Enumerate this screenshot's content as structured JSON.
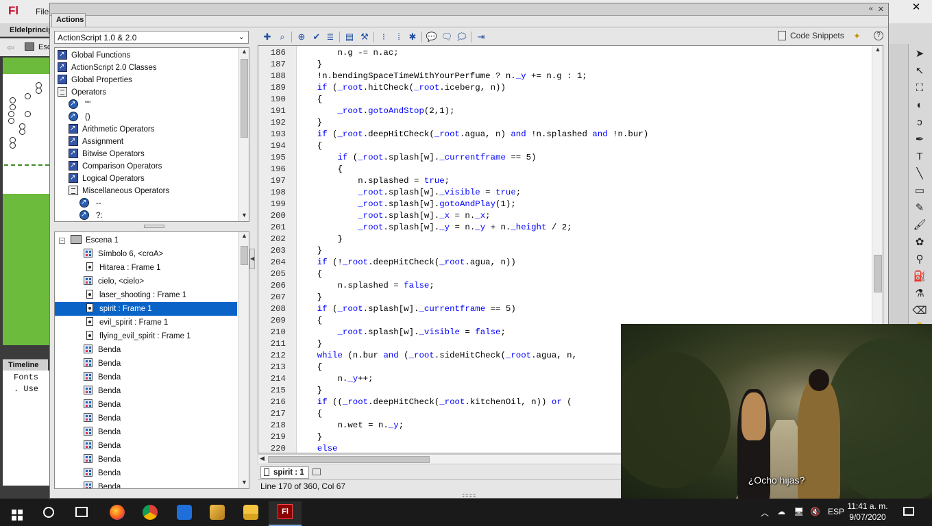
{
  "app": {
    "logo": "Fl",
    "menu_file": "File",
    "document_tab": "Eldelprincip",
    "scene_crumb": "Esc"
  },
  "actions_panel": {
    "title": "Actions",
    "version_select": "ActionScript 1.0 & 2.0",
    "code_snippets_label": "Code Snippets",
    "help_label": "?"
  },
  "toolbox": {
    "items": [
      {
        "label": "Global Functions",
        "icon": "book-icon"
      },
      {
        "label": "ActionScript 2.0 Classes",
        "icon": "book-icon"
      },
      {
        "label": "Global Properties",
        "icon": "book-icon"
      },
      {
        "label": "Operators",
        "icon": "open-book-icon"
      },
      {
        "label": "\"\"",
        "icon": "action-icon"
      },
      {
        "label": "()",
        "icon": "action-icon"
      },
      {
        "label": "Arithmetic Operators",
        "icon": "book-icon"
      },
      {
        "label": "Assignment",
        "icon": "book-icon"
      },
      {
        "label": "Bitwise Operators",
        "icon": "book-icon"
      },
      {
        "label": "Comparison Operators",
        "icon": "book-icon"
      },
      {
        "label": "Logical Operators",
        "icon": "book-icon"
      },
      {
        "label": "Miscellaneous Operators",
        "icon": "open-book-icon"
      },
      {
        "label": "--",
        "icon": "action-icon"
      },
      {
        "label": "?:",
        "icon": "action-icon"
      }
    ]
  },
  "script_navigator": {
    "items": [
      {
        "label": "Escena 1",
        "type": "scene"
      },
      {
        "label": "Símbolo 6, <croA>",
        "type": "movieclip"
      },
      {
        "label": "Hitarea : Frame 1",
        "type": "frame"
      },
      {
        "label": "cielo, <cielo>",
        "type": "movieclip"
      },
      {
        "label": "laser_shooting : Frame 1",
        "type": "frame"
      },
      {
        "label": "spirit : Frame 1",
        "type": "frame",
        "selected": true
      },
      {
        "label": "evil_spirit : Frame 1",
        "type": "frame"
      },
      {
        "label": "flying_evil_spirit : Frame 1",
        "type": "frame"
      },
      {
        "label": "Benda",
        "type": "movieclip"
      },
      {
        "label": "Benda",
        "type": "movieclip"
      },
      {
        "label": "Benda",
        "type": "movieclip"
      },
      {
        "label": "Benda",
        "type": "movieclip"
      },
      {
        "label": "Benda",
        "type": "movieclip"
      },
      {
        "label": "Benda",
        "type": "movieclip"
      },
      {
        "label": "Benda",
        "type": "movieclip"
      },
      {
        "label": "Benda",
        "type": "movieclip"
      },
      {
        "label": "Benda",
        "type": "movieclip"
      },
      {
        "label": "Benda",
        "type": "movieclip"
      },
      {
        "label": "Benda",
        "type": "movieclip"
      }
    ]
  },
  "code": {
    "lines": [
      {
        "n": "186",
        "text": "        n.g -= n.ac;"
      },
      {
        "n": "187",
        "text": "    }"
      },
      {
        "n": "188",
        "text": "    !n.bendingSpaceTimeWithYourPerfume ? n._y += n.g : 1;"
      },
      {
        "n": "189",
        "text": "    if (_root.hitCheck(_root.iceberg, n))"
      },
      {
        "n": "190",
        "text": "    {"
      },
      {
        "n": "191",
        "text": "        _root.gotoAndStop(2,1);"
      },
      {
        "n": "192",
        "text": "    }"
      },
      {
        "n": "193",
        "text": "    if (_root.deepHitCheck(_root.agua, n) and !n.splashed and !n.bur)"
      },
      {
        "n": "194",
        "text": "    {"
      },
      {
        "n": "195",
        "text": "        if (_root.splash[w]._currentframe == 5)"
      },
      {
        "n": "196",
        "text": "        {"
      },
      {
        "n": "197",
        "text": "            n.splashed = true;"
      },
      {
        "n": "198",
        "text": "            _root.splash[w]._visible = true;"
      },
      {
        "n": "199",
        "text": "            _root.splash[w].gotoAndPlay(1);"
      },
      {
        "n": "200",
        "text": "            _root.splash[w]._x = n._x;"
      },
      {
        "n": "201",
        "text": "            _root.splash[w]._y = n._y + n._height / 2;"
      },
      {
        "n": "202",
        "text": "        }"
      },
      {
        "n": "203",
        "text": "    }"
      },
      {
        "n": "204",
        "text": "    if (!_root.deepHitCheck(_root.agua, n))"
      },
      {
        "n": "205",
        "text": "    {"
      },
      {
        "n": "206",
        "text": "        n.splashed = false;"
      },
      {
        "n": "207",
        "text": "    }"
      },
      {
        "n": "208",
        "text": "    if (_root.splash[w]._currentframe == 5)"
      },
      {
        "n": "209",
        "text": "    {"
      },
      {
        "n": "210",
        "text": "        _root.splash[w]._visible = false;"
      },
      {
        "n": "211",
        "text": "    }"
      },
      {
        "n": "212",
        "text": "    while (n.bur and (_root.sideHitCheck(_root.agua, n,"
      },
      {
        "n": "213",
        "text": "    {"
      },
      {
        "n": "214",
        "text": "        n._y++;"
      },
      {
        "n": "215",
        "text": "    }"
      },
      {
        "n": "216",
        "text": "    if ((_root.deepHitCheck(_root.kitchenOil, n)) or ("
      },
      {
        "n": "217",
        "text": "    {"
      },
      {
        "n": "218",
        "text": "        n.wet = n._y;"
      },
      {
        "n": "219",
        "text": "    }"
      },
      {
        "n": "220",
        "text": "    else"
      }
    ]
  },
  "script_tab": {
    "label": "spirit : 1"
  },
  "status": {
    "position": "Line 170 of 360, Col 67"
  },
  "timeline": {
    "tab_label": "Timeline",
    "line1": "Fonts",
    "line2": ". Use"
  },
  "video": {
    "subtitle": "¿Ocho hijas?"
  },
  "taskbar": {
    "language": "ESP",
    "time": "11:41 a. m.",
    "date": "9/07/2020"
  }
}
